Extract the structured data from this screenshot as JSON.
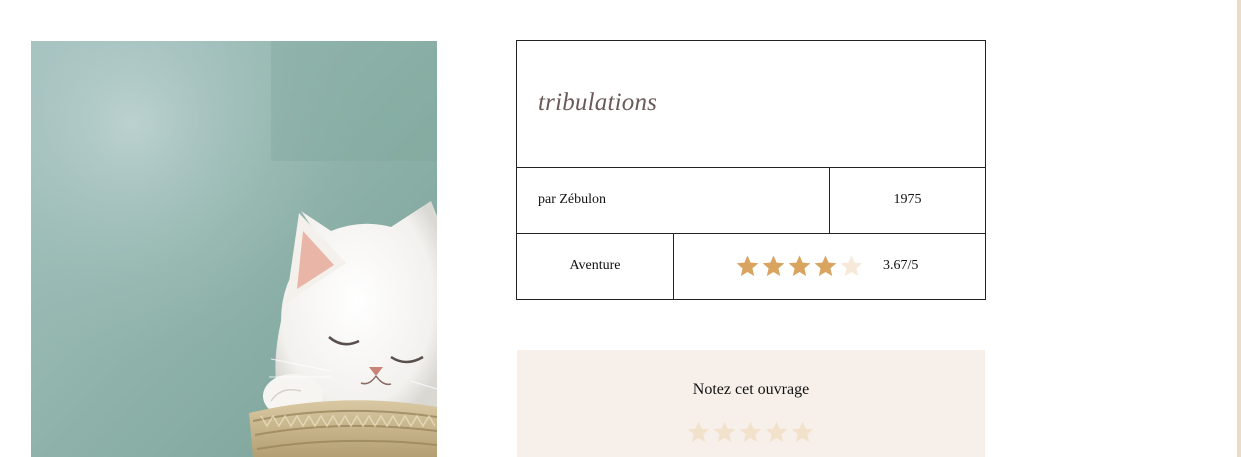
{
  "book": {
    "title": "tribulations",
    "author_line": "par Zébulon",
    "year": "1975",
    "genre": "Aventure",
    "rating_value": 3.67,
    "rating_max": 5,
    "rating_text": "3.67/5"
  },
  "cover": {
    "image_name": "sleeping-kitten-in-basket"
  },
  "rate_panel": {
    "title": "Notez cet ouvrage",
    "stars_count": 5,
    "user_rating": 0
  },
  "colors": {
    "star_filled": "#d8a460",
    "star_empty": "#f6e9da",
    "rate_star": "#f2e2cc",
    "title_color": "#6b5a58",
    "panel_bg": "#f7f0ea",
    "rail": "#eadcc8"
  }
}
